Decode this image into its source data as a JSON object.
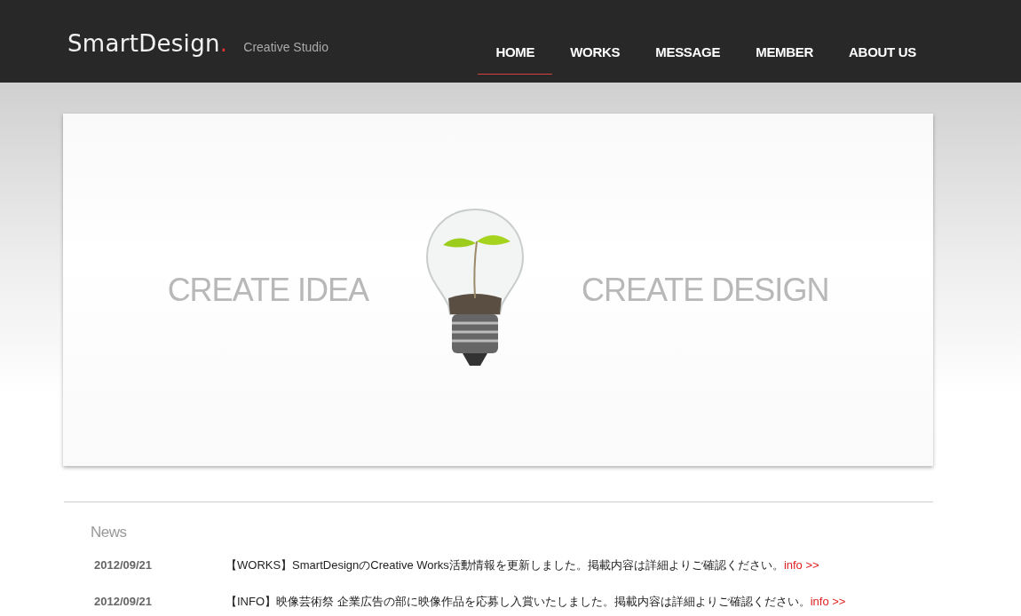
{
  "header": {
    "logo": {
      "name": "SmartDesign",
      "dot": "."
    },
    "tagline": "Creative Studio"
  },
  "nav": [
    {
      "label": "HOME",
      "selected": true
    },
    {
      "label": "WORKS",
      "selected": false
    },
    {
      "label": "MESSAGE",
      "selected": false
    },
    {
      "label": "MEMBER",
      "selected": false
    },
    {
      "label": "ABOUT US",
      "selected": false
    }
  ],
  "hero": {
    "left": "CREATE IDEA",
    "right": "CREATE DESIGN"
  },
  "news": {
    "title": "News",
    "items": [
      {
        "date": "2012/09/21",
        "text": "【WORKS】SmartDesignのCreative Works活動情報を更新しました。掲載内容は詳細よりご確認ください。",
        "link": "info >>"
      },
      {
        "date": "2012/09/21",
        "text": "【INFO】映像芸術祭 企業広告の部に映像作品を応募し入賞いたしました。掲載内容は詳細よりご確認ください。",
        "link": "info >>"
      }
    ]
  }
}
